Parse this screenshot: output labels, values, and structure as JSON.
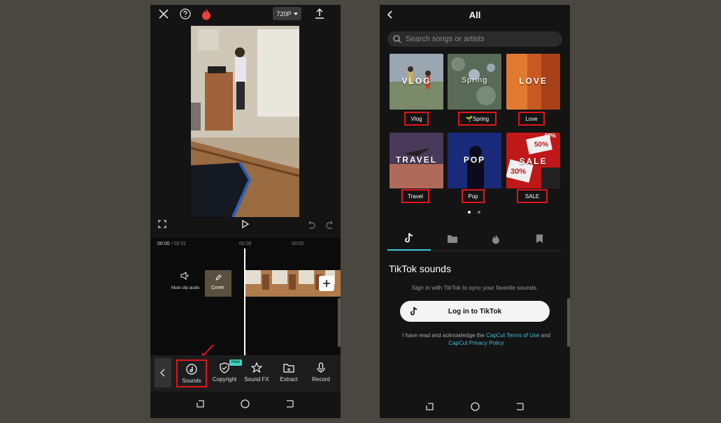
{
  "left_screen": {
    "top_bar": {
      "resolution": "720P"
    },
    "timeline": {
      "timecode_current": "00:00",
      "timecode_total": "/ 02:01",
      "ruler_marks": [
        "00:00",
        "00:02"
      ],
      "mute_label": "Mute clip audio",
      "cover_label": "Cover"
    },
    "toolbar": {
      "new_badge": "New",
      "tools": [
        {
          "label": "Sounds",
          "icon": "music-note-icon"
        },
        {
          "label": "Copyright",
          "icon": "shield-check-icon"
        },
        {
          "label": "Sound FX",
          "icon": "star-music-icon"
        },
        {
          "label": "Extract",
          "icon": "folder-music-icon"
        },
        {
          "label": "Record",
          "icon": "microphone-icon"
        }
      ]
    }
  },
  "right_screen": {
    "header": {
      "title": "All"
    },
    "search": {
      "placeholder": "Search songs or artists"
    },
    "categories": [
      {
        "cover_text": "VLOG",
        "label": "Vlog"
      },
      {
        "cover_text": "Spring",
        "label": "🌱Spring"
      },
      {
        "cover_text": "LOVE",
        "label": "Love"
      },
      {
        "cover_text": "TRAVEL",
        "label": "Travel"
      },
      {
        "cover_text": "POP",
        "label": "Pop"
      },
      {
        "cover_text": "SALE",
        "label": "SALE"
      }
    ],
    "sale_tile_texts": [
      "50%",
      "50%",
      "30%"
    ],
    "tabs": [
      {
        "icon": "tiktok-icon",
        "active": true
      },
      {
        "icon": "folder-icon",
        "active": false
      },
      {
        "icon": "flame-icon",
        "active": false
      },
      {
        "icon": "bookmark-icon",
        "active": false
      }
    ],
    "tiktok": {
      "title": "TikTok sounds",
      "subtitle": "Sign in with TikTok to sync your favorite sounds.",
      "login_button": "Log in to TikTok",
      "legal_prefix": "I have read and acknowledge the",
      "terms_link": "CapCut Terms of Use",
      "legal_and": "and",
      "privacy_link": "CapCut Privacy Policy"
    }
  },
  "colors": {
    "background": "#4a4740",
    "phone_bg": "#141414",
    "highlight_red": "#e0151b",
    "link_cyan": "#3fbfd6",
    "new_badge": "#3fd6c6"
  }
}
